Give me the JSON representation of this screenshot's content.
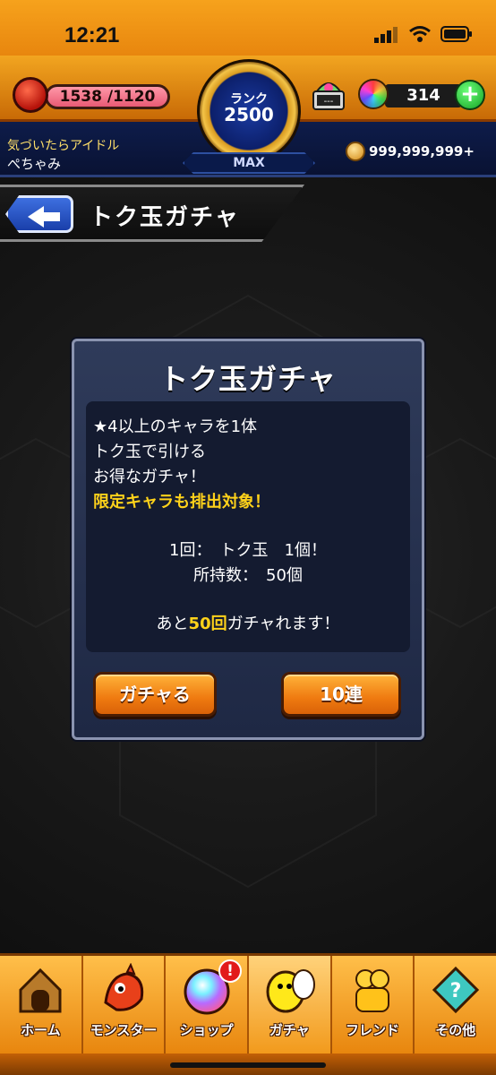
{
  "status_bar": {
    "time": "12:21"
  },
  "hud": {
    "stamina": "1538 /1120",
    "rank_label": "ランク",
    "rank_value": "2500",
    "rank_max": "MAX",
    "lamp_value": "---",
    "orbs": "314",
    "player_title": "気づいたらアイドル",
    "player_name": "ぺちゃみ",
    "coins": "999,999,999+"
  },
  "header": {
    "title": "トク玉ガチャ"
  },
  "dialog": {
    "title": "トク玉ガチャ",
    "lines": [
      "★4以上のキャラを1体",
      "トク玉で引ける",
      "お得なガチャ！"
    ],
    "highlight_line": "限定キャラも排出対象！",
    "cost_line": "1回：　トク玉　1個！",
    "owned_line": "所持数：　50個",
    "remaining_prefix": "あと",
    "remaining_count": "50回",
    "remaining_suffix": "ガチャれます！",
    "button_single": "ガチャる",
    "button_ten": "10連"
  },
  "nav": {
    "items": [
      {
        "label": "ホーム"
      },
      {
        "label": "モンスター"
      },
      {
        "label": "ショップ",
        "badge": "!"
      },
      {
        "label": "ガチャ"
      },
      {
        "label": "フレンド"
      },
      {
        "label": "その他"
      }
    ]
  },
  "colors": {
    "accent": "#ef7a10",
    "highlight": "#ffd21a",
    "dialog": "#2f3b5a"
  }
}
